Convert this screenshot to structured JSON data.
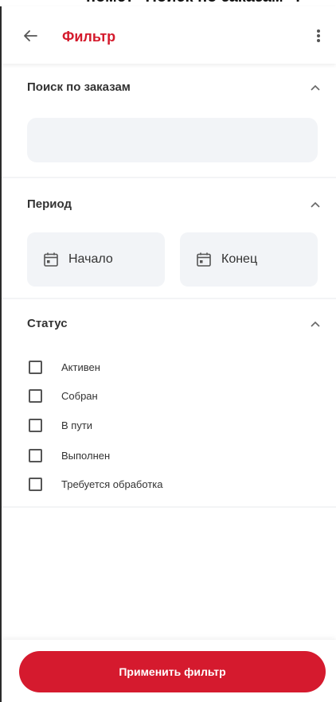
{
  "top_caption": "помет \"Поиск по заказам\" :",
  "appbar": {
    "title": "Фильтр",
    "back_icon": "arrow-left-icon",
    "more_icon": "more-vert-icon"
  },
  "sections": {
    "order_search": {
      "title": "Поиск по заказам",
      "input_value": "",
      "input_placeholder": "",
      "expanded": true
    },
    "period": {
      "title": "Период",
      "start_label": "Начало",
      "end_label": "Конец",
      "expanded": true
    },
    "status": {
      "title": "Статус",
      "expanded": true,
      "options": [
        {
          "label": "Активен",
          "checked": false
        },
        {
          "label": "Собран",
          "checked": false
        },
        {
          "label": "В пути",
          "checked": false
        },
        {
          "label": "Выполнен",
          "checked": false
        },
        {
          "label": "Требуется обработка",
          "checked": false
        }
      ]
    }
  },
  "apply_button": "Применить фильтр",
  "colors": {
    "accent": "#d51a2e",
    "field_background": "#f2f4f7",
    "page_background": "#ffffff"
  }
}
